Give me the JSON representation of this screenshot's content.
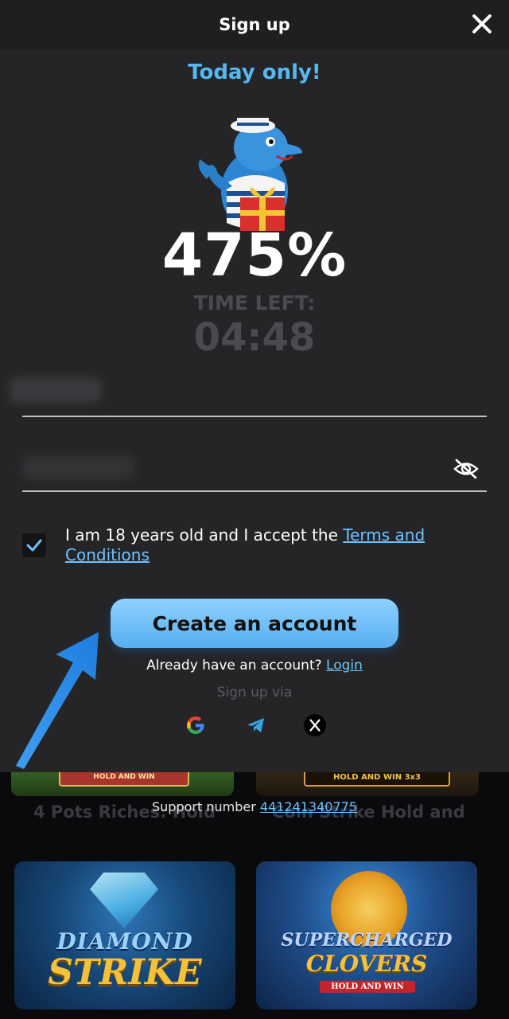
{
  "modal": {
    "title": "Sign up",
    "promo": "Today only!",
    "bonus_percent": "475%",
    "time_left_label": "TIME LEFT:",
    "time_left_value": "04:48",
    "terms_text": "I am 18 years old and I accept the ",
    "terms_link": "Terms and Conditions",
    "terms_checked": true,
    "create_button": "Create an account",
    "already_text": "Already have an account? ",
    "login_link": "Login",
    "signup_via": "Sign up via",
    "social_icons": [
      "google-icon",
      "telegram-icon",
      "x-icon"
    ]
  },
  "background": {
    "games": [
      {
        "title": "4 Pots Riches: Hold"
      },
      {
        "title": "Coin Strike Hold and"
      }
    ],
    "tiles": [
      {
        "logo_line1": "DIAMOND",
        "logo_line2": "STRIKE"
      },
      {
        "logo_line1": "SUPERCHARGED",
        "logo_line2": "CLOVERS",
        "logo_line3": "HOLD AND WIN"
      }
    ],
    "top_banners": [
      "HOLD AND WIN",
      "HOLD AND WIN 3x3"
    ],
    "support_label": "Support number ",
    "support_number": "441241340775"
  },
  "colors": {
    "accent": "#55b9f0",
    "link": "#6fc2ff",
    "modal_bg": "#252527",
    "button_top": "#8fd2ff",
    "button_bottom": "#56aef0"
  }
}
